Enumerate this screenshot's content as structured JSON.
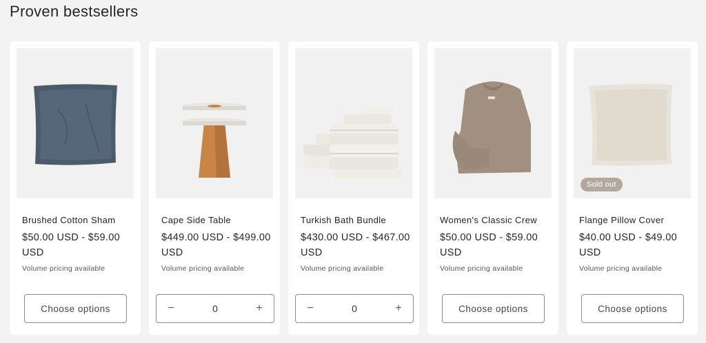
{
  "section": {
    "title": "Proven bestsellers"
  },
  "products": [
    {
      "title": "Brushed Cotton Sham",
      "price": "$50.00 USD - $59.00 USD",
      "volume": "Volume pricing available",
      "action": "Choose options",
      "image_icon": "pillow-sham-icon"
    },
    {
      "title": "Cape Side Table",
      "price": "$449.00 USD - $499.00 USD",
      "volume": "Volume pricing available",
      "qty": {
        "minus": "−",
        "value": "0",
        "plus": "+"
      },
      "image_icon": "side-table-icon"
    },
    {
      "title": "Turkish Bath Bundle",
      "price": "$430.00 USD - $467.00 USD",
      "volume": "Volume pricing available",
      "qty": {
        "minus": "−",
        "value": "0",
        "plus": "+"
      },
      "image_icon": "towel-stack-icon"
    },
    {
      "title": "Women's Classic Crew",
      "price": "$50.00 USD - $59.00 USD",
      "volume": "Volume pricing available",
      "action": "Choose options",
      "image_icon": "sweater-icon"
    },
    {
      "title": "Flange Pillow Cover",
      "price": "$40.00 USD - $49.00 USD",
      "volume": "Volume pricing available",
      "action": "Choose options",
      "badge": "Sold out",
      "image_icon": "pillow-cover-icon"
    }
  ],
  "colors": {
    "background": "#f3f3f3",
    "card": "#ffffff",
    "badge": "#b3a89d",
    "border": "#8a8a8a"
  }
}
